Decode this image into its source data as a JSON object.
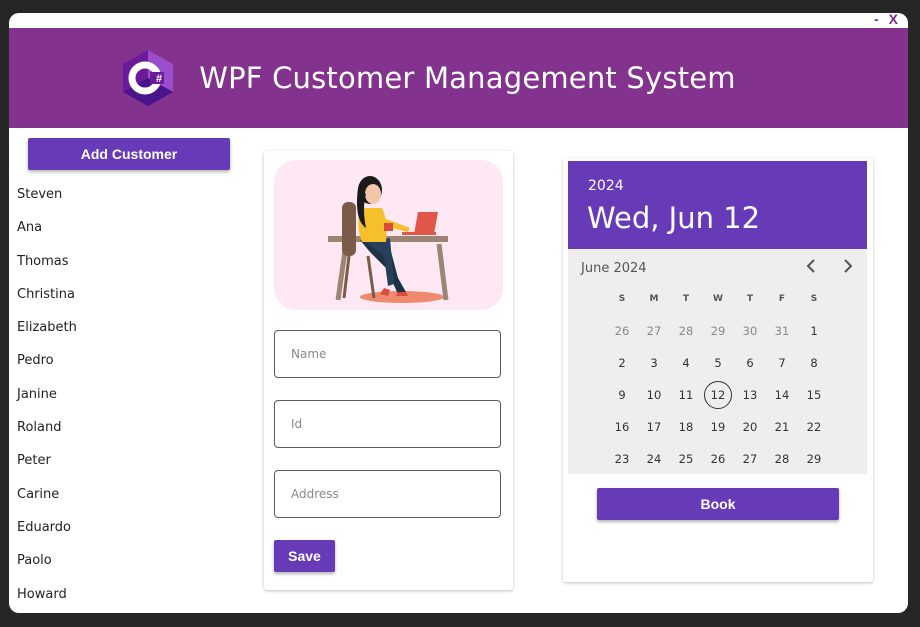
{
  "window": {
    "minimize_label": "-",
    "close_label": "X"
  },
  "header": {
    "title": "WPF Customer Management System",
    "logo_icon": "csharp-logo-icon",
    "logo_text": "C#"
  },
  "colors": {
    "header_bg": "#83338d",
    "accent": "#673ab7",
    "illustration_bg": "#fde8f4"
  },
  "sidebar": {
    "add_button_label": "Add Customer",
    "customers": [
      "Steven",
      "Ana",
      "Thomas",
      "Christina",
      "Elizabeth",
      "Pedro",
      "Janine",
      "Roland",
      "Peter",
      "Carine",
      "Eduardo",
      "Paolo",
      "Howard"
    ]
  },
  "form": {
    "illustration_icon": "woman-at-laptop-illustration",
    "name_placeholder": "Name",
    "id_placeholder": "Id",
    "address_placeholder": "Address",
    "save_label": "Save"
  },
  "calendar": {
    "year": "2024",
    "selected_date": "Wed, Jun 12",
    "month_label": "June 2024",
    "prev_icon": "chevron-left-icon",
    "next_icon": "chevron-right-icon",
    "weekdays": [
      "S",
      "M",
      "T",
      "W",
      "T",
      "F",
      "S"
    ],
    "weeks": [
      [
        "26",
        "27",
        "28",
        "29",
        "30",
        "31",
        "1"
      ],
      [
        "2",
        "3",
        "4",
        "5",
        "6",
        "7",
        "8"
      ],
      [
        "9",
        "10",
        "11",
        "12",
        "13",
        "14",
        "15"
      ],
      [
        "16",
        "17",
        "18",
        "19",
        "20",
        "21",
        "22"
      ],
      [
        "23",
        "24",
        "25",
        "26",
        "27",
        "28",
        "29"
      ]
    ],
    "other_month_days_first_week": 6,
    "today": "12",
    "book_label": "Book"
  }
}
